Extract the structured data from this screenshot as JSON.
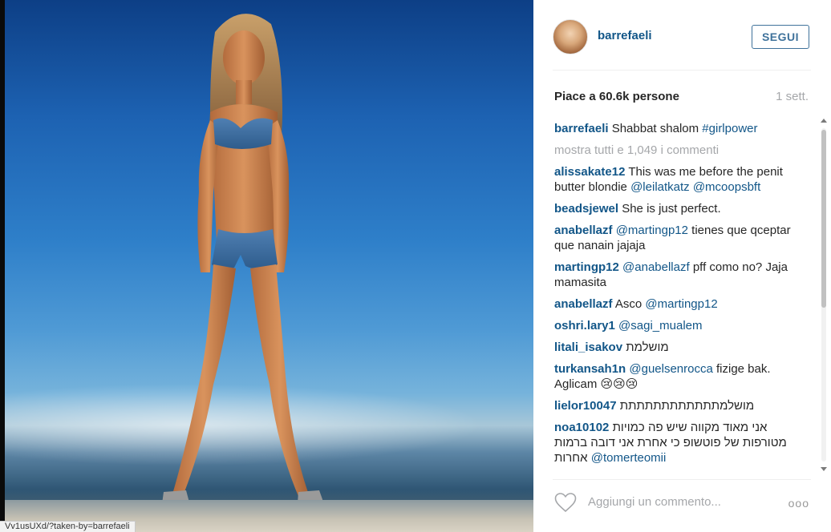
{
  "photo": {
    "alt_icon": "photo"
  },
  "header": {
    "username": "barrefaeli",
    "follow_label": "SEGUI"
  },
  "meta": {
    "likes": "Piace a 60.6k persone",
    "age": "1 sett."
  },
  "caption": {
    "user": "barrefaeli",
    "text": " Shabbat shalom ",
    "hashtag": "#girlpower"
  },
  "show_all": "mostra tutti e 1,049 i commenti",
  "comments": [
    {
      "user": "alissakate12",
      "text": " This was me before the penit butter blondie ",
      "mentions": "@leilatkatz @mcoopsbft",
      "tail": ""
    },
    {
      "user": "beadsjewel",
      "text": " She is just perfect.",
      "mentions": "",
      "tail": ""
    },
    {
      "user": "anabellazf",
      "text": " ",
      "mentions": "@martingp12",
      "tail": " tienes que qceptar que nanain jajaja"
    },
    {
      "user": "martingp12",
      "text": " ",
      "mentions": "@anabellazf",
      "tail": " pff como no? Jaja mamasita"
    },
    {
      "user": "anabellazf",
      "text": " Asco ",
      "mentions": "@martingp12",
      "tail": ""
    },
    {
      "user": "oshri.lary1",
      "text": " ",
      "mentions": "@sagi_mualem",
      "tail": ""
    },
    {
      "user": "litali_isakov",
      "text": " מושלמת",
      "mentions": "",
      "tail": ""
    },
    {
      "user": "turkansah1n",
      "text": " ",
      "mentions": "@guelsenrocca",
      "tail": " fizige bak. Aglicam 😢😢😢"
    },
    {
      "user": "lielor10047",
      "text": " מושלמתתתתתתתתתתתת",
      "mentions": "",
      "tail": ""
    },
    {
      "user": "noa10102",
      "text": " אני מאוד מקווה שיש פה כמויות מטורפות של פוטשופ כי אחרת אני דובה ברמות אחרות ",
      "mentions": "@tomerteomii",
      "tail": ""
    }
  ],
  "footer": {
    "comment_placeholder": "Aggiungi un commento...",
    "more_label": "ooo"
  },
  "status_url": "Vv1usUXd/?taken-by=barrefaeli",
  "colors": {
    "link": "#125688",
    "muted": "#a5a7aa",
    "follow": "#3f729b"
  }
}
